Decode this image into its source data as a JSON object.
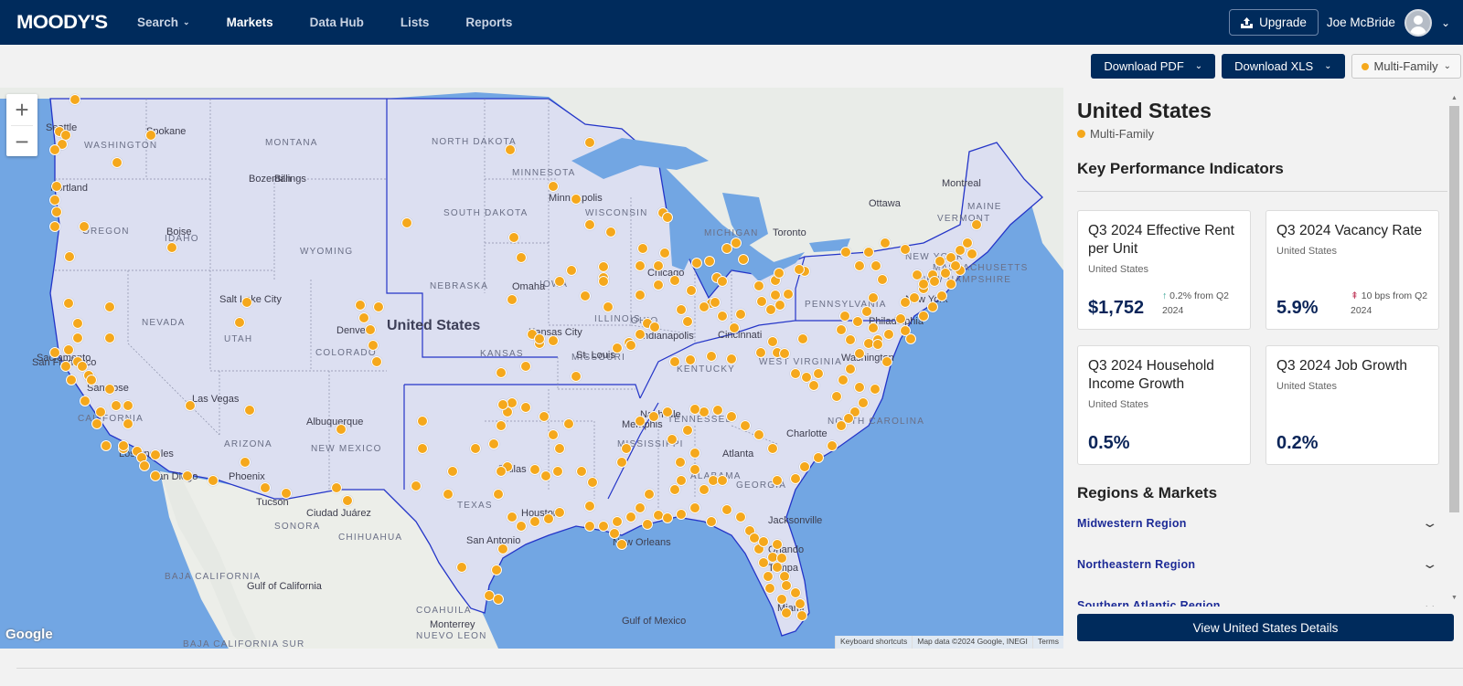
{
  "header": {
    "logo": "MOODY'S",
    "nav": [
      {
        "label": "Search",
        "has_dropdown": true,
        "active": false
      },
      {
        "label": "Markets",
        "has_dropdown": false,
        "active": true
      },
      {
        "label": "Data Hub",
        "has_dropdown": false,
        "active": false
      },
      {
        "label": "Lists",
        "has_dropdown": false,
        "active": false
      },
      {
        "label": "Reports",
        "has_dropdown": false,
        "active": false
      }
    ],
    "upgrade_label": "Upgrade",
    "user_name": "Joe McBride"
  },
  "toolbar": {
    "download_pdf": "Download PDF",
    "download_xls": "Download XLS",
    "property_type": "Multi-Family",
    "property_type_color": "#f5a81c"
  },
  "map": {
    "country_label": "United States",
    "zoom_in": "+",
    "zoom_out": "−",
    "provider_logo": "Google",
    "attribution": [
      "Keyboard shortcuts",
      "Map data ©2024 Google, INEGI",
      "Terms"
    ],
    "state_labels": [
      "WASHINGTON",
      "OREGON",
      "IDAHO",
      "MONTANA",
      "WYOMING",
      "NEVADA",
      "UTAH",
      "COLORADO",
      "ARIZONA",
      "NEW MEXICO",
      "CALIFORNIA",
      "NORTH DAKOTA",
      "SOUTH DAKOTA",
      "NEBRASKA",
      "KANSAS",
      "MINNESOTA",
      "WISCONSIN",
      "IOWA",
      "MISSOURI",
      "ILLINOIS",
      "MICHIGAN",
      "OHIO",
      "KENTUCKY",
      "TENNESSEE",
      "TEXAS",
      "MISSISSIPPI",
      "ALABAMA",
      "GEORGIA",
      "PENNSYLVANIA",
      "NEW YORK",
      "VERMONT",
      "MAINE",
      "NEW HAMPSHIRE",
      "MASSACHUSETTS",
      "WEST VIRGINIA",
      "NORTH CAROLINA",
      "SONORA",
      "CHIHUAHUA",
      "COAHUILA",
      "NUEVO LEON",
      "BAJA CALIFORNIA",
      "BAJA CALIFORNIA SUR"
    ],
    "city_labels": [
      "Seattle",
      "Spokane",
      "Portland",
      "Boise",
      "Billings",
      "Bozeman",
      "Salt Lake City",
      "Denver",
      "Sacramento",
      "San Francisco",
      "San Jose",
      "Las Vegas",
      "Los Angeles",
      "San Diego",
      "Phoenix",
      "Tucson",
      "Albuquerque",
      "Ciudad Juárez",
      "Minneapolis",
      "Omaha",
      "Kansas City",
      "St. Louis",
      "Chicago",
      "Indianapolis",
      "Cincinnati",
      "Nashville",
      "Memphis",
      "Atlanta",
      "Charlotte",
      "Dallas",
      "Houston",
      "San Antonio",
      "New Orleans",
      "Jacksonville",
      "Orlando",
      "Tampa",
      "Miami",
      "Washington",
      "Philadelphia",
      "New York",
      "Toronto",
      "Ottawa",
      "Montreal",
      "Monterrey",
      "Gulf of Mexico",
      "Gulf of California"
    ],
    "marker_color": "#f5a81c"
  },
  "panel": {
    "country": "United States",
    "property_type": "Multi-Family",
    "kpi_heading": "Key Performance Indicators",
    "kpis": [
      {
        "title": "Q3 2024 Effective Rent per Unit",
        "location": "United States",
        "value": "$1,752",
        "change_arrow": "↑",
        "change_direction": "up",
        "change_text": "0.2% from Q2 2024"
      },
      {
        "title": "Q3 2024 Vacancy Rate",
        "location": "United States",
        "value": "5.9%",
        "change_arrow": "⇞",
        "change_direction": "down",
        "change_text": "10 bps from Q2 2024"
      },
      {
        "title": "Q3 2024 Household Income Growth",
        "location": "United States",
        "value": "0.5%",
        "change_arrow": "",
        "change_direction": "",
        "change_text": ""
      },
      {
        "title": "Q3 2024 Job Growth",
        "location": "United States",
        "value": "0.2%",
        "change_arrow": "",
        "change_direction": "",
        "change_text": ""
      }
    ],
    "regions_heading": "Regions & Markets",
    "regions": [
      {
        "label": "Midwestern Region"
      },
      {
        "label": "Northeastern Region"
      },
      {
        "label": "Southern Atlantic Region"
      }
    ],
    "view_details_label": "View United States Details"
  }
}
